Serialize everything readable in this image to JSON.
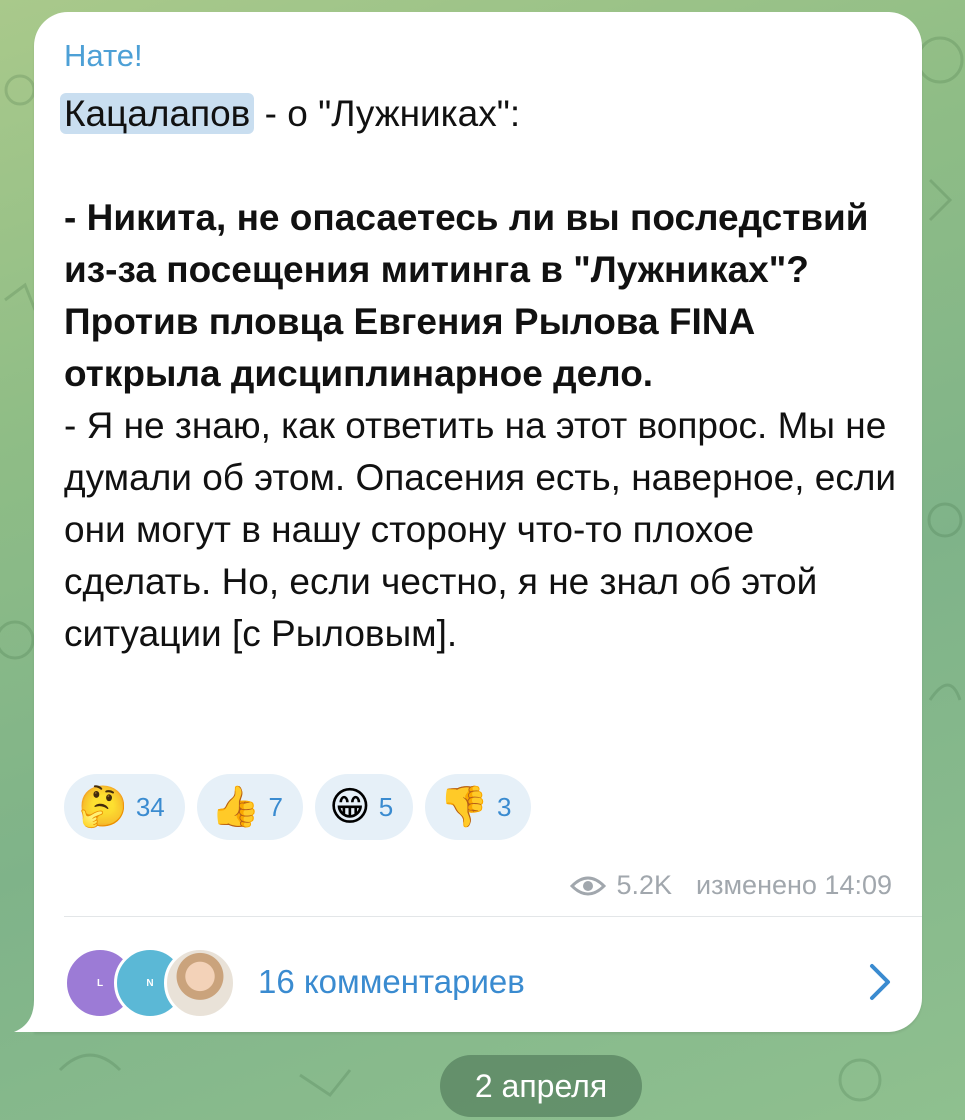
{
  "message": {
    "sender": "Нате!",
    "mention": "Кацалапов",
    "intro_rest": " - о \"Лужниках\":",
    "question": "- Никита, не опасаетесь ли вы последствий из-за посещения митинга в \"Лужниках\"? Против пловца Евгения Рылова FINA открыла дисциплинарное дело.",
    "answer": "- Я не знаю, как ответить на этот вопрос. Мы не думали об этом. Опасения есть, наверное, если они могут в нашу сторону что-то плохое сделать. Но, если честно, я не знал об этой ситуации [с Рыловым].",
    "reactions": [
      {
        "emoji": "🤔",
        "count": "34"
      },
      {
        "emoji": "👍",
        "count": "7"
      },
      {
        "emoji": "😁",
        "count": "5"
      },
      {
        "emoji": "👎",
        "count": "3"
      }
    ],
    "views": "5.2K",
    "edited_time": "изменено 14:09",
    "comments_label": "16 комментариев",
    "avatar_initials": [
      "L",
      "N"
    ]
  },
  "date_separator": "2 апреля",
  "icons": {
    "views": "eye-icon",
    "chevron": "chevron-right-icon"
  },
  "colors": {
    "accent": "#3a8bd0",
    "mention_bg": "#c9def0",
    "bubble": "#ffffff"
  }
}
